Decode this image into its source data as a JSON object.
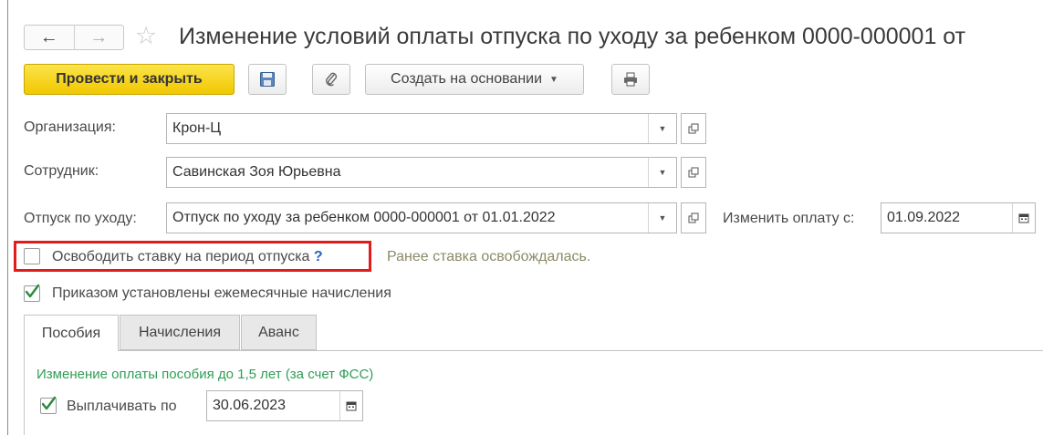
{
  "window": {
    "title": "Изменение условий оплаты отпуска по уходу за ребенком 0000-000001 от",
    "nav_back": "←",
    "nav_forward": "→",
    "favorite_icon": "star-icon"
  },
  "toolbar": {
    "post_and_close": "Провести и закрыть",
    "save_icon": "save-icon",
    "attach_icon": "paperclip-icon",
    "create_based_on": "Создать на основании",
    "print_icon": "printer-icon"
  },
  "form": {
    "organization": {
      "label": "Организация:",
      "value": "Крон-Ц"
    },
    "employee": {
      "label": "Сотрудник:",
      "value": "Савинская Зоя Юрьевна"
    },
    "leave": {
      "label": "Отпуск по уходу:",
      "value": "Отпуск по уходу за ребенком 0000-000001 от 01.01.2022"
    },
    "change_from": {
      "label": "Изменить оплату с:",
      "value": "01.09.2022"
    },
    "free_rate": {
      "label": "Освободить ставку на период отпуска",
      "help": "?",
      "checked": false,
      "note": "Ранее ставка освобождалась."
    },
    "monthly_accruals": {
      "label": "Приказом установлены ежемесячные начисления",
      "checked": true
    }
  },
  "tabs": [
    {
      "label": "Пособия",
      "active": true
    },
    {
      "label": "Начисления",
      "active": false
    },
    {
      "label": "Аванс",
      "active": false
    }
  ],
  "benefits": {
    "section_title": "Изменение оплаты пособия до 1,5 лет (за счет ФСС)",
    "pay_until": {
      "label": "Выплачивать по",
      "value": "30.06.2023",
      "checked": true
    }
  },
  "colors": {
    "primary_button": "#f5d20c",
    "highlight_frame": "#e21b1b",
    "section_title": "#2f9e55",
    "checkmark": "#2a8a3a"
  }
}
